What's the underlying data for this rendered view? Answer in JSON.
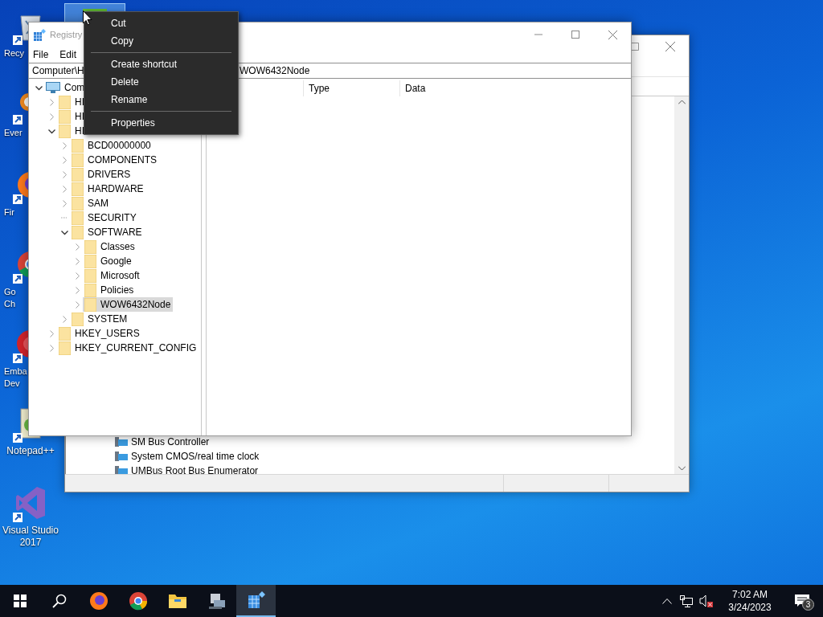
{
  "desktop_icons": [
    {
      "kind": "recycle",
      "label": [
        "Recy"
      ],
      "covered": true
    },
    {
      "kind": "everything",
      "label": [
        "Ever"
      ],
      "covered": true
    },
    {
      "kind": "firefox",
      "label": [
        "Fir"
      ],
      "covered": true
    },
    {
      "kind": "chrome",
      "label": [
        "Go",
        "Ch"
      ],
      "covered": true
    },
    {
      "kind": "embarcadero",
      "label": [
        "Emba",
        "Dev"
      ],
      "covered": true
    },
    {
      "kind": "notepad",
      "label": [
        "Notepad++"
      ],
      "covered": false
    },
    {
      "kind": "vs",
      "label": [
        "Visual Studio",
        "2017"
      ],
      "covered": false
    }
  ],
  "highlighted_icon": {
    "selected": true
  },
  "device_manager": {
    "devices": [
      "SM Bus Controller",
      "System CMOS/real time clock",
      "UMBus Root Bus Enumerator"
    ]
  },
  "registry": {
    "title": "Registry",
    "menu": [
      "File",
      "Edit"
    ],
    "address_start": "Computer\\H",
    "address_end": "WOW6432Node",
    "tree": [
      {
        "label": "Com",
        "kind": "computer",
        "expanded": true,
        "expandable": true,
        "selected": false,
        "children": [
          {
            "label": "HI",
            "kind": "folder",
            "expanded": false,
            "expandable": true,
            "selected": false
          },
          {
            "label": "HI",
            "kind": "folder",
            "expanded": false,
            "expandable": true,
            "selected": false
          },
          {
            "label": "HI",
            "kind": "folder",
            "expanded": true,
            "expandable": true,
            "selected": false,
            "children": [
              {
                "label": "BCD00000000",
                "kind": "folder",
                "expanded": false,
                "expandable": true,
                "selected": false
              },
              {
                "label": "COMPONENTS",
                "kind": "folder",
                "expanded": false,
                "expandable": true,
                "selected": false
              },
              {
                "label": "DRIVERS",
                "kind": "folder",
                "expanded": false,
                "expandable": true,
                "selected": false
              },
              {
                "label": "HARDWARE",
                "kind": "folder",
                "expanded": false,
                "expandable": true,
                "selected": false
              },
              {
                "label": "SAM",
                "kind": "folder",
                "expanded": false,
                "expandable": true,
                "selected": false
              },
              {
                "label": "SECURITY",
                "kind": "folder",
                "expandable": false,
                "selected": false
              },
              {
                "label": "SOFTWARE",
                "kind": "folder",
                "expanded": true,
                "expandable": true,
                "selected": false,
                "children": [
                  {
                    "label": "Classes",
                    "kind": "folder",
                    "expanded": false,
                    "expandable": true,
                    "selected": false
                  },
                  {
                    "label": "Google",
                    "kind": "folder",
                    "expanded": false,
                    "expandable": true,
                    "selected": false
                  },
                  {
                    "label": "Microsoft",
                    "kind": "folder",
                    "expanded": false,
                    "expandable": true,
                    "selected": false
                  },
                  {
                    "label": "Policies",
                    "kind": "folder",
                    "expanded": false,
                    "expandable": true,
                    "selected": false
                  },
                  {
                    "label": "WOW6432Node",
                    "kind": "folder",
                    "expanded": false,
                    "expandable": true,
                    "selected": true
                  }
                ]
              },
              {
                "label": "SYSTEM",
                "kind": "folder",
                "expanded": false,
                "expandable": true,
                "selected": false
              }
            ]
          },
          {
            "label": "HKEY_USERS",
            "kind": "folder",
            "expanded": false,
            "expandable": true,
            "selected": false
          },
          {
            "label": "HKEY_CURRENT_CONFIG",
            "kind": "folder",
            "expanded": false,
            "expandable": true,
            "selected": false
          }
        ]
      }
    ],
    "columns": [
      "Type",
      "Data"
    ]
  },
  "context_menu": [
    {
      "kind": "item",
      "label": "Cut"
    },
    {
      "kind": "item",
      "label": "Copy"
    },
    {
      "kind": "separator"
    },
    {
      "kind": "item",
      "label": "Create shortcut"
    },
    {
      "kind": "item",
      "label": "Delete"
    },
    {
      "kind": "item",
      "label": "Rename"
    },
    {
      "kind": "separator"
    },
    {
      "kind": "item",
      "label": "Properties"
    }
  ],
  "taskbar": {
    "apps": [
      {
        "kind": "start",
        "active": false
      },
      {
        "kind": "search",
        "active": false
      },
      {
        "kind": "firefox",
        "active": false
      },
      {
        "kind": "chrome",
        "active": false
      },
      {
        "kind": "explorer",
        "active": false
      },
      {
        "kind": "device",
        "active": false
      },
      {
        "kind": "regedit",
        "active": true
      }
    ],
    "time": "7:02 AM",
    "date": "3/24/2023",
    "notifications": "3"
  }
}
